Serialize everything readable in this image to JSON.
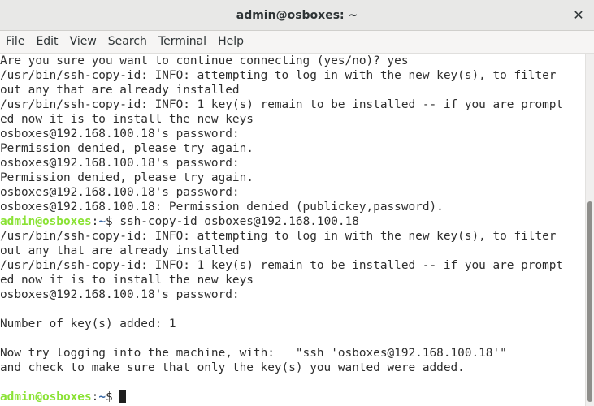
{
  "window": {
    "title": "admin@osboxes: ~",
    "close_label": "✕"
  },
  "menu": {
    "items": [
      "File",
      "Edit",
      "View",
      "Search",
      "Terminal",
      "Help"
    ]
  },
  "prompt": {
    "user": "admin@osboxes",
    "separator": ":",
    "path": "~",
    "symbol": "$"
  },
  "terminal": {
    "lines": [
      {
        "text": "Are you sure you want to continue connecting (yes/no)? yes"
      },
      {
        "text": "/usr/bin/ssh-copy-id: INFO: attempting to log in with the new key(s), to filter"
      },
      {
        "text": "out any that are already installed"
      },
      {
        "text": "/usr/bin/ssh-copy-id: INFO: 1 key(s) remain to be installed -- if you are prompt"
      },
      {
        "text": "ed now it is to install the new keys"
      },
      {
        "text": "osboxes@192.168.100.18's password: "
      },
      {
        "text": "Permission denied, please try again."
      },
      {
        "text": "osboxes@192.168.100.18's password: "
      },
      {
        "text": "Permission denied, please try again."
      },
      {
        "text": "osboxes@192.168.100.18's password: "
      },
      {
        "text": "osboxes@192.168.100.18: Permission denied (publickey,password)."
      },
      {
        "prompt": true,
        "text": " ssh-copy-id osboxes@192.168.100.18"
      },
      {
        "text": "/usr/bin/ssh-copy-id: INFO: attempting to log in with the new key(s), to filter"
      },
      {
        "text": "out any that are already installed"
      },
      {
        "text": "/usr/bin/ssh-copy-id: INFO: 1 key(s) remain to be installed -- if you are prompt"
      },
      {
        "text": "ed now it is to install the new keys"
      },
      {
        "text": "osboxes@192.168.100.18's password: "
      },
      {
        "text": ""
      },
      {
        "text": "Number of key(s) added: 1"
      },
      {
        "text": ""
      },
      {
        "text": "Now try logging into the machine, with:   \"ssh 'osboxes@192.168.100.18'\""
      },
      {
        "text": "and check to make sure that only the key(s) you wanted were added."
      },
      {
        "text": ""
      },
      {
        "prompt": true,
        "text": " ",
        "cursor": true
      }
    ]
  },
  "scrollbar": {
    "position_fraction": 0.42,
    "visible_fraction": 0.57
  },
  "colors": {
    "prompt_user": "#8ae234",
    "prompt_path": "#3465a4",
    "text": "#2e2e2e",
    "background": "#ffffff"
  }
}
